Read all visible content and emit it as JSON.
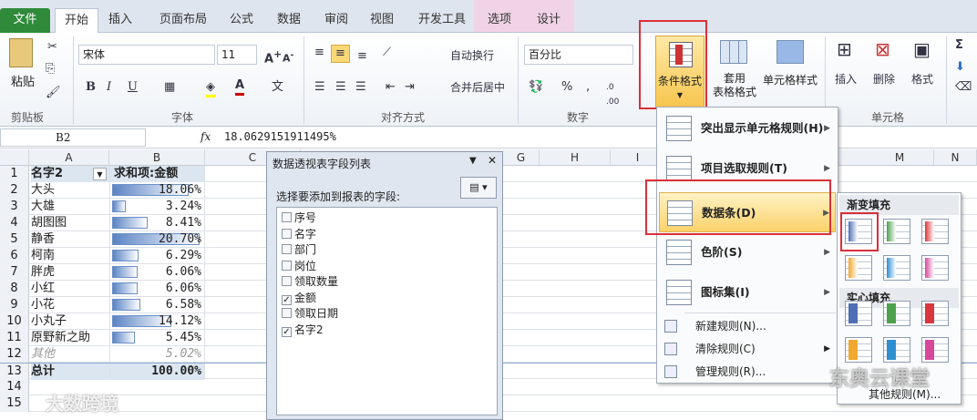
{
  "tabs": [
    "文件",
    "开始",
    "插入",
    "页面布局",
    "公式",
    "数据",
    "审阅",
    "视图",
    "开发工具",
    "选项",
    "设计"
  ],
  "ribbon": {
    "clipboard": {
      "paste": "粘贴",
      "label": "剪贴板"
    },
    "font": {
      "name": "宋体",
      "size": "11",
      "label": "字体",
      "bold": "B",
      "italic": "I",
      "underline": "U"
    },
    "alignment": {
      "wrap": "自动换行",
      "merge": "合并后居中",
      "label": "对齐方式"
    },
    "number": {
      "format": "百分比",
      "percent": "%",
      "comma": ",",
      "label": "数字"
    },
    "styles": {
      "conditional": "条件格式",
      "table_fmt_1": "套用",
      "table_fmt_2": "表格格式",
      "cell_styles": "单元格样式"
    },
    "cells": {
      "insert": "插入",
      "delete": "删除",
      "format": "格式",
      "label": "单元格"
    },
    "editing": {
      "sum": "Σ"
    }
  },
  "formula_bar": {
    "name_box": "B2",
    "fx": "fx",
    "formula": "18.0629151911495%"
  },
  "columns": [
    "A",
    "B",
    "C",
    "G",
    "H",
    "I",
    "M",
    "N"
  ],
  "sheet": {
    "header": {
      "a": "名字2",
      "b": "求和项:金额"
    },
    "rows": [
      {
        "n": "2",
        "a": "大头",
        "b": "18.06%",
        "v": 18.06
      },
      {
        "n": "3",
        "a": "大雄",
        "b": "3.24%",
        "v": 3.24
      },
      {
        "n": "4",
        "a": "胡图图",
        "b": "8.41%",
        "v": 8.41
      },
      {
        "n": "5",
        "a": "静香",
        "b": "20.70%",
        "v": 20.7
      },
      {
        "n": "6",
        "a": "柯南",
        "b": "6.29%",
        "v": 6.29
      },
      {
        "n": "7",
        "a": "胖虎",
        "b": "6.06%",
        "v": 6.06
      },
      {
        "n": "8",
        "a": "小红",
        "b": "6.06%",
        "v": 6.06
      },
      {
        "n": "9",
        "a": "小花",
        "b": "6.58%",
        "v": 6.58
      },
      {
        "n": "10",
        "a": "小丸子",
        "b": "14.12%",
        "v": 14.12
      },
      {
        "n": "11",
        "a": "原野新之助",
        "b": "5.45%",
        "v": 5.45
      },
      {
        "n": "12",
        "a": "其他",
        "b": "5.02%",
        "v": null
      }
    ],
    "total": {
      "n": "13",
      "a": "总计",
      "b": "100.00%"
    },
    "extra_rows": [
      "14",
      "15"
    ],
    "bar_color": "#5b84c4"
  },
  "pivot": {
    "title": "数据透视表字段列表",
    "prompt": "选择要添加到报表的字段:",
    "fields": [
      {
        "label": "序号",
        "checked": false
      },
      {
        "label": "名字",
        "checked": false
      },
      {
        "label": "部门",
        "checked": false
      },
      {
        "label": "岗位",
        "checked": false
      },
      {
        "label": "领取数量",
        "checked": false
      },
      {
        "label": "金额",
        "checked": true
      },
      {
        "label": "领取日期",
        "checked": false
      },
      {
        "label": "名字2",
        "checked": true
      }
    ]
  },
  "menu": {
    "items": [
      "突出显示单元格规则(H)",
      "项目选取规则(T)",
      "数据条(D)",
      "色阶(S)",
      "图标集(I)"
    ],
    "small": [
      "新建规则(N)...",
      "清除规则(C)",
      "管理规则(R)..."
    ]
  },
  "submenu": {
    "gradient": "渐变填充",
    "solid": "实心填充",
    "more": "其他规则(M)...",
    "colors": [
      "#4f6fb5",
      "#4ea24e",
      "#d9363e",
      "#f0a830",
      "#2f8fd0",
      "#d6489c"
    ]
  },
  "watermarks": [
    "大数跨境",
    "东奥云课堂"
  ]
}
